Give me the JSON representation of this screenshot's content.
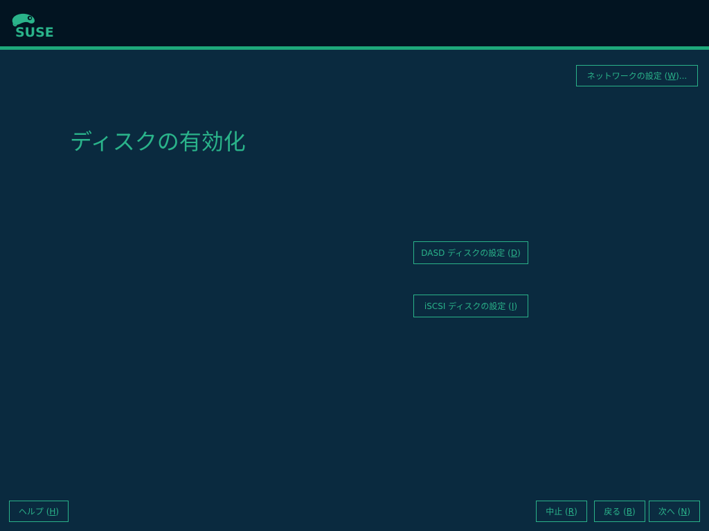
{
  "header": {
    "brand": "SUSE",
    "logo_icon": "suse-chameleon-logo"
  },
  "main": {
    "title": "ディスクの有効化",
    "network_button": {
      "prefix": "ネットワークの設定 (",
      "key": "W",
      "suffix": ")..."
    },
    "dasd_button": {
      "prefix": "DASD ディスクの設定 (",
      "key": "D",
      "suffix": ")"
    },
    "iscsi_button": {
      "prefix": "iSCSI ディスクの設定 (",
      "key": "I",
      "suffix": ")"
    }
  },
  "footer": {
    "help": {
      "prefix": "ヘルプ (",
      "key": "H",
      "suffix": ")"
    },
    "abort": {
      "prefix": "中止 (",
      "key": "R",
      "suffix": ")"
    },
    "back": {
      "prefix": "戻る (",
      "key": "B",
      "suffix": ")"
    },
    "next": {
      "prefix": "次へ (",
      "key": "N",
      "suffix": ")"
    }
  },
  "colors": {
    "accent": "#2ab38a",
    "background": "#0a2a3f",
    "header": "#021421",
    "header_line": "#1ea87a"
  }
}
